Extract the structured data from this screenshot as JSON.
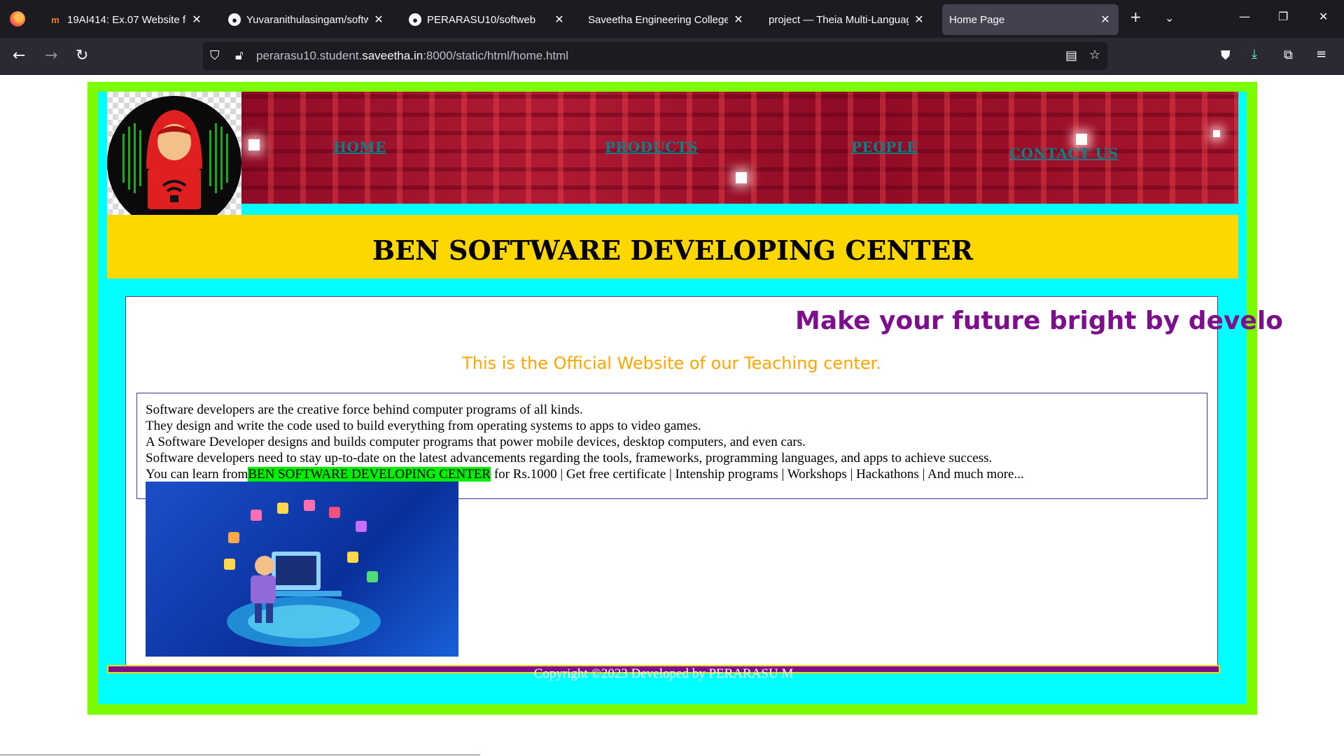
{
  "browser": {
    "tabs": [
      {
        "label": "19AI414: Ex.07 Website for S",
        "icon": "moodle-icon"
      },
      {
        "label": "Yuvaranithulasingam/softw",
        "icon": "github-icon"
      },
      {
        "label": "PERARASU10/softweb",
        "icon": "github-icon"
      },
      {
        "label": "Saveetha Engineering College",
        "icon": "none"
      },
      {
        "label": "project — Theia Multi-Languag",
        "icon": "none"
      },
      {
        "label": "Home Page",
        "icon": "none"
      }
    ],
    "url": {
      "prefix": "perarasu10.student.",
      "domain": "saveetha.in",
      "suffix": ":8000/static/html/home.html"
    }
  },
  "page": {
    "nav": [
      "HOME",
      "PRODUCTS",
      "PEOPLE",
      "CONTACT US"
    ],
    "title": "BEN SOFTWARE DEVELOPING CENTER",
    "marquee": "Make your future bright by develo",
    "subtitle": "This is the Official Website of our Teaching center.",
    "info_lines": [
      "Software developers are the creative force behind computer programs of all kinds.",
      "They design and write the code used to build everything from operating systems to apps to video games.",
      "A Software Developer designs and builds computer programs that power mobile devices, desktop computers, and even cars.",
      "Software developers need to stay up-to-date on the latest advancements regarding the tools, frameworks, programming languages, and apps to achieve success."
    ],
    "learn_prefix": "You can learn from",
    "learn_highlight": "BEN SOFTWARE DEVELOPING CENTER",
    "learn_suffix": " for Rs.1000 | Get free certificate | Intenship programs | Workshops | Hackathons | And much more...",
    "footer": "Copyright ©2023 Developed by PERARASU M"
  },
  "colors": {
    "outer_border": "#7cfc00",
    "page_bg": "#00ffff",
    "title_bg": "#ffd700",
    "marquee": "#7d0f8c",
    "subtitle": "#ffa500",
    "highlight": "#00ee00",
    "nav_link": "#0e7f87"
  }
}
